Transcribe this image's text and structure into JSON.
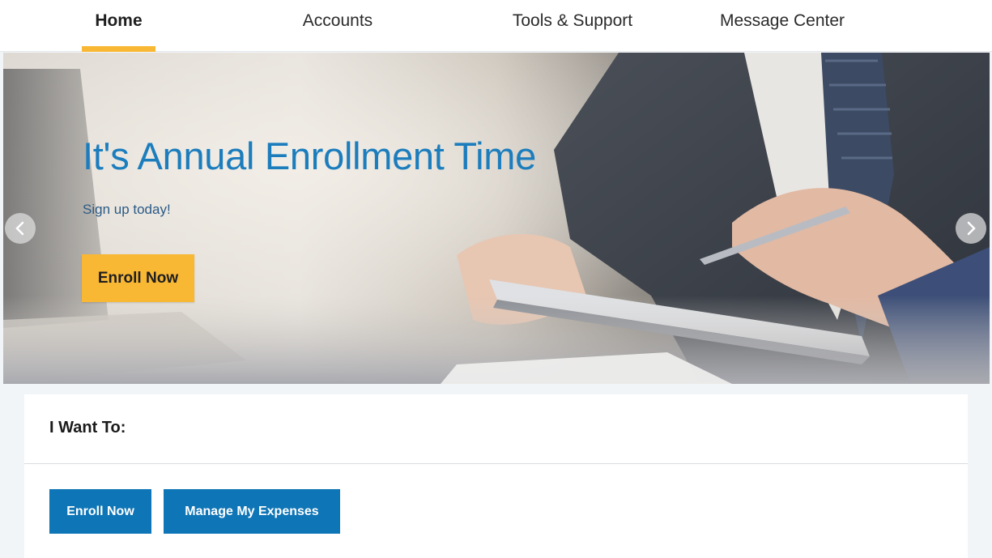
{
  "nav": {
    "tabs": [
      {
        "label": "Home",
        "active": true
      },
      {
        "label": "Accounts",
        "active": false
      },
      {
        "label": "Tools & Support",
        "active": false
      },
      {
        "label": "Message Center",
        "active": false
      }
    ]
  },
  "hero": {
    "title": "It's Annual Enrollment Time",
    "subtitle": "Sign up today!",
    "button_label": "Enroll Now"
  },
  "actions": {
    "heading": "I Want To:",
    "buttons": [
      {
        "label": "Enroll Now"
      },
      {
        "label": "Manage My Expenses"
      }
    ]
  },
  "colors": {
    "accent": "#f9b834",
    "primary": "#0e75b6",
    "title_blue": "#1c7dbd"
  },
  "icons": {
    "carousel_prev": "chevron-left-icon",
    "carousel_next": "chevron-right-icon"
  }
}
